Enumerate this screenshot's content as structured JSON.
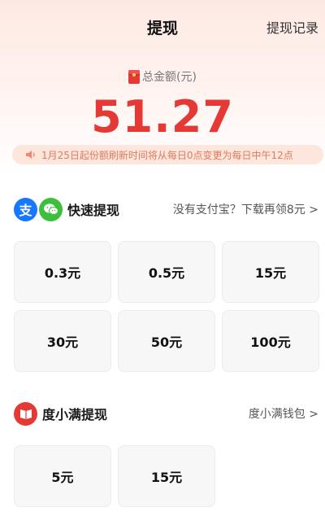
{
  "header": {
    "title": "提现",
    "history_link": "提现记录"
  },
  "balance": {
    "label": "总金额(元)",
    "amount": "51.27",
    "icon": "red-packet-icon"
  },
  "notice": {
    "icon": "speaker-icon",
    "text": "1月25日起份额刷新时间将从每日0点变更为每日中午12点"
  },
  "quick_withdraw": {
    "title": "快速提现",
    "icons": [
      "alipay-icon",
      "wechat-icon"
    ],
    "alipay_glyph": "支",
    "right_link": "没有支付宝？下载再领8元 >",
    "options": [
      "0.3元",
      "0.5元",
      "15元",
      "30元",
      "50元",
      "100元"
    ]
  },
  "duxiaoman_withdraw": {
    "title": "度小满提现",
    "icon": "duxiaoman-icon",
    "right_link": "度小满钱包 >",
    "options": [
      "5元",
      "15元"
    ]
  },
  "colors": {
    "accent": "#e53935",
    "alipay": "#1677ff",
    "wechat": "#3cbf3c",
    "notice_bg": "#fde6dc"
  }
}
